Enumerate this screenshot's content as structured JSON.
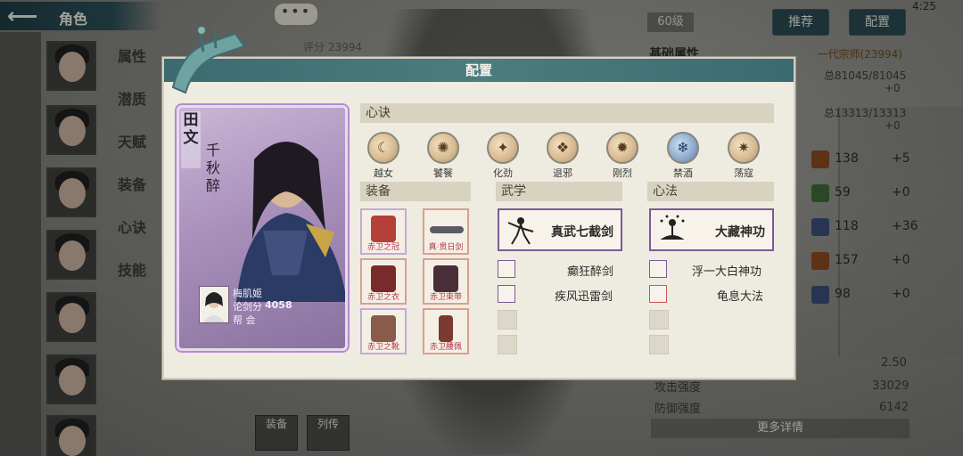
{
  "topbar": {
    "back_title": "角色",
    "chat_dots": "•••",
    "level": "60级",
    "recommend_label": "推荐",
    "config_label": "配置",
    "status_text": "4:25"
  },
  "background": {
    "score_text": "评分 23994"
  },
  "side_menu": {
    "items": [
      "属性",
      "潜质",
      "天赋",
      "装备",
      "心诀",
      "技能"
    ]
  },
  "stats": {
    "title": "基础属性",
    "rank": "一代宗师(23994)",
    "lines": [
      "总81045/81045",
      "+0",
      "总13313/13313",
      "+0"
    ],
    "rows": [
      {
        "value": "138",
        "inc": "+5"
      },
      {
        "value": "59",
        "inc": "+0"
      },
      {
        "value": "118",
        "inc": "+36"
      },
      {
        "value": "157",
        "inc": "+0"
      },
      {
        "value": "98",
        "inc": "+0"
      }
    ],
    "crit_value": "2.50",
    "attack_label": "攻击强度",
    "attack_value": "33029",
    "defense_label": "防御强度",
    "defense_value": "6142",
    "more_label": "更多详情"
  },
  "bottom_tabs": [
    "装备",
    "列传"
  ],
  "modal": {
    "title": "配置",
    "card": {
      "title": "田文",
      "subtitle": "千秋醉",
      "player_name": "梅肌姬",
      "score_label": "论剑分",
      "score_value": "4058",
      "guild_label": "帮  会"
    },
    "xinjue_header": "心诀",
    "xinjue": [
      {
        "name": "越女",
        "glyph": "☾"
      },
      {
        "name": "饕餮",
        "glyph": "✺"
      },
      {
        "name": "化劲",
        "glyph": "✦"
      },
      {
        "name": "退邪",
        "glyph": "❖"
      },
      {
        "name": "刚烈",
        "glyph": "✹"
      },
      {
        "name": "禁酒",
        "glyph": "❄"
      },
      {
        "name": "荡寇",
        "glyph": "✷"
      }
    ],
    "equip_header": "装备",
    "equipment": [
      {
        "label": "赤卫之冠",
        "color": "#b5403a"
      },
      {
        "label": "真·贯日剑",
        "color": "#5b5b66"
      },
      {
        "label": "赤卫之衣",
        "color": "#7a2a2a"
      },
      {
        "label": "赤卫束带",
        "color": "#4a2f3a"
      },
      {
        "label": "赤卫之靴",
        "color": "#8a5a4a"
      },
      {
        "label": "赤卫腰佩",
        "color": "#7a3a30"
      }
    ],
    "wuxue_header": "武学",
    "wuxue_main": "真武七截剑",
    "wuxue_sub": [
      "癫狂醉剑",
      "疾风迅雷剑"
    ],
    "xinfa_header": "心法",
    "xinfa_main": "大藏神功",
    "xinfa_sub": [
      "浮一大白神功",
      "龟息大法"
    ]
  }
}
